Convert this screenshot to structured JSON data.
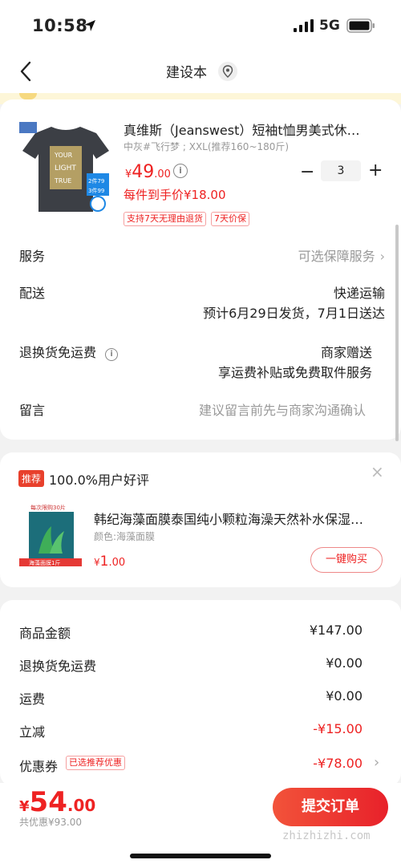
{
  "status_bar": {
    "time": "10:58",
    "network": "5G"
  },
  "nav": {
    "title": "建设本",
    "back_icon": "chevron-left-icon",
    "location_icon": "location-pin-icon"
  },
  "product": {
    "title": "真维斯（Jeanswest）短袖t恤男美式休…",
    "spec": "中灰#飞行梦 ; XXL(推荐160~180斤)",
    "price_symbol": "¥",
    "price_int": "49",
    "price_dec": ".00",
    "quantity": "3",
    "unit_price": "每件到手价¥18.00",
    "tags": [
      "支持7天无理由退货",
      "7天价保"
    ],
    "image_text": {
      "line1": "YOUR",
      "line2": "LIGHT",
      "line3": "TRUE",
      "promo1": "2件79",
      "promo2": "3件99"
    }
  },
  "rows": {
    "service_label": "服务",
    "service_value": "可选保障服务",
    "delivery_label": "配送",
    "delivery_value": "快递运输",
    "delivery_eta": "预计6月29日发货，7月1日送达",
    "return_label": "退换货免运费",
    "return_value": "商家赠送",
    "return_desc": "享运费补贴或免费取件服务",
    "note_label": "留言",
    "note_placeholder": "建议留言前先与商家沟通确认"
  },
  "recommend": {
    "badge": "推荐",
    "heading": "100.0%用户好评",
    "title": "韩纪海藻面膜泰国纯小颗粒海澡天然补水保湿…",
    "spec": "颜色:海藻面膜",
    "price_symbol": "¥",
    "price_int": "1",
    "price_dec": ".00",
    "buy_label": "一键购买",
    "image_text": {
      "top": "每次限购30片",
      "bottom": "海藻面膜1斤"
    }
  },
  "summary": {
    "items": [
      {
        "label": "商品金额",
        "value": "¥147.00"
      },
      {
        "label": "退换货免运费",
        "value": "¥0.00"
      },
      {
        "label": "运费",
        "value": "¥0.00"
      },
      {
        "label": "立减",
        "value": "-¥15.00"
      },
      {
        "label": "优惠券",
        "value": "-¥78.00"
      }
    ],
    "coupon_tag": "已选推荐优惠"
  },
  "bottom": {
    "total_symbol": "¥",
    "total_int": "54",
    "total_dec": ".00",
    "saved": "共优惠¥93.00",
    "submit_label": "提交订单",
    "watermark": "zhizhizhi.com"
  }
}
